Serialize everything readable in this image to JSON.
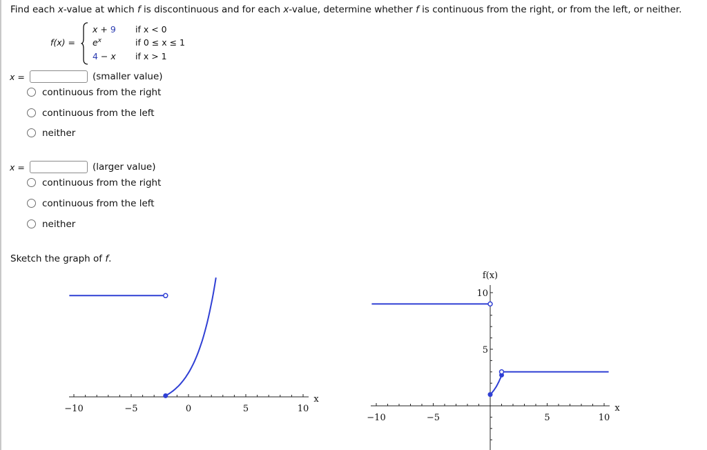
{
  "question": {
    "text_parts": [
      "Find each ",
      "x",
      "-value at which ",
      "f",
      " is discontinuous and for each ",
      "x",
      "-value, determine whether ",
      "f",
      " is continuous from the right, or from the left, or neither."
    ]
  },
  "piecewise": {
    "lhs": "f(x) =",
    "pieces": [
      {
        "expr_var": "x",
        "expr_op": " + ",
        "expr_const": "9",
        "cond": "if x < 0"
      },
      {
        "expr_var": "e",
        "expr_sup": "x",
        "cond": "if 0 ≤ x ≤ 1"
      },
      {
        "expr_const": "4",
        "expr_op": " − ",
        "expr_var": "x",
        "cond": "if x > 1"
      }
    ]
  },
  "answers": [
    {
      "x_label": "x =",
      "input_value": "",
      "hint": "(smaller value)",
      "options": [
        "continuous from the right",
        "continuous from the left",
        "neither"
      ]
    },
    {
      "x_label": "x =",
      "input_value": "",
      "hint": "(larger value)",
      "options": [
        "continuous from the right",
        "continuous from the left",
        "neither"
      ]
    }
  ],
  "sketch_prompt": {
    "text": "Sketch the graph of ",
    "var": "f",
    "end": "."
  },
  "colors": {
    "curve": "#2f3fd4",
    "axis": "#222222",
    "accent_number": "#2a3bb0"
  },
  "chart_data": [
    {
      "type": "line",
      "name": "graph-option-1",
      "xlabel": "x",
      "ylabel": "",
      "xlim": [
        -10,
        10
      ],
      "x_ticks": [
        -10,
        -5,
        0,
        5,
        10
      ],
      "tick_labels": [
        "−10",
        "−5",
        "0",
        "5",
        "10"
      ],
      "show_y_axis": false,
      "segments": [
        {
          "kind": "line",
          "points": [
            [
              -10.4,
              9
            ],
            [
              -2,
              9
            ]
          ],
          "end_open": true
        },
        {
          "kind": "exp-curve",
          "from_x": -2,
          "base_y": 0,
          "to_x": 2.4,
          "top_y": 10.5,
          "start_closed": true
        }
      ]
    },
    {
      "type": "line",
      "name": "graph-option-2",
      "xlabel": "x",
      "ylabel": "f(x)",
      "xlim": [
        -10,
        10
      ],
      "ylim": [
        -4,
        10
      ],
      "x_ticks": [
        -10,
        -5,
        5,
        10
      ],
      "x_tick_labels": [
        "−10",
        "−5",
        "5",
        "10"
      ],
      "y_ticks": [
        5,
        10
      ],
      "y_tick_labels": [
        "5",
        "10"
      ],
      "segments": [
        {
          "kind": "line",
          "points": [
            [
              -10.4,
              9
            ],
            [
              0,
              9
            ]
          ],
          "end_open": true
        },
        {
          "kind": "exp",
          "from_x": 0,
          "to_x": 1,
          "start_closed": true,
          "end_closed": true
        },
        {
          "kind": "line",
          "points": [
            [
              1,
              3
            ],
            [
              10.4,
              3
            ]
          ],
          "start_open": true
        }
      ]
    }
  ]
}
